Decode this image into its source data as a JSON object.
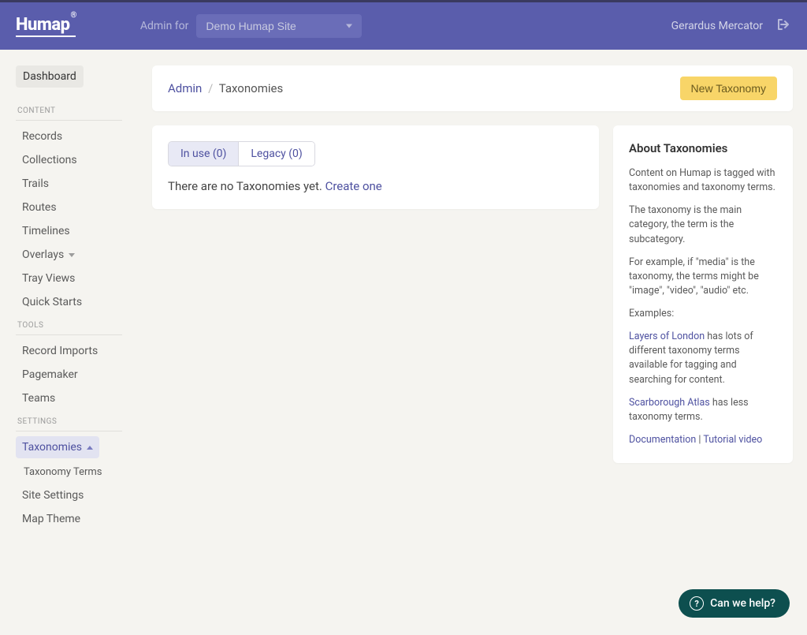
{
  "header": {
    "logo": "Humap",
    "logo_sup": "®",
    "admin_for": "Admin for",
    "site_selected": "Demo Humap Site",
    "username": "Gerardus Mercator"
  },
  "sidebar": {
    "dashboard": "Dashboard",
    "sections": [
      {
        "heading": "CONTENT",
        "items": [
          {
            "label": "Records",
            "key": "records"
          },
          {
            "label": "Collections",
            "key": "collections"
          },
          {
            "label": "Trails",
            "key": "trails"
          },
          {
            "label": "Routes",
            "key": "routes"
          },
          {
            "label": "Timelines",
            "key": "timelines"
          },
          {
            "label": "Overlays",
            "key": "overlays",
            "caret": true
          },
          {
            "label": "Tray Views",
            "key": "tray-views"
          },
          {
            "label": "Quick Starts",
            "key": "quick-starts"
          }
        ]
      },
      {
        "heading": "TOOLS",
        "items": [
          {
            "label": "Record Imports",
            "key": "record-imports"
          },
          {
            "label": "Pagemaker",
            "key": "pagemaker"
          },
          {
            "label": "Teams",
            "key": "teams"
          }
        ]
      },
      {
        "heading": "SETTINGS",
        "items": [
          {
            "label": "Taxonomies",
            "key": "taxonomies",
            "active": true,
            "sub": "Taxonomy Terms"
          },
          {
            "label": "Site Settings",
            "key": "site-settings"
          },
          {
            "label": "Map Theme",
            "key": "map-theme"
          }
        ]
      }
    ]
  },
  "breadcrumb": {
    "root": "Admin",
    "sep": "/",
    "current": "Taxonomies",
    "button": "New Taxonomy"
  },
  "tabs": {
    "in_use": "In use (0)",
    "legacy": "Legacy (0)"
  },
  "empty": {
    "msg": "There are no Taxonomies yet. ",
    "link": "Create one"
  },
  "about": {
    "title": "About Taxonomies",
    "p1": "Content on Humap is tagged with taxonomies and taxonomy terms.",
    "p2": "The taxonomy is the main category, the term is the subcategory.",
    "p3": "For example, if \"media\" is the taxonomy, the terms might be \"image\", \"video\", \"audio\" etc.",
    "p4": "Examples:",
    "ex1_link": "Layers of London",
    "ex1_text": " has lots of different taxonomy terms available for tagging and searching for content.",
    "ex2_link": "Scarborough Atlas",
    "ex2_text": " has less taxonomy terms.",
    "doc_link": "Documentation",
    "doc_sep": " | ",
    "tut_link": "Tutorial video"
  },
  "help": {
    "label": "Can we help?",
    "q": "?"
  }
}
